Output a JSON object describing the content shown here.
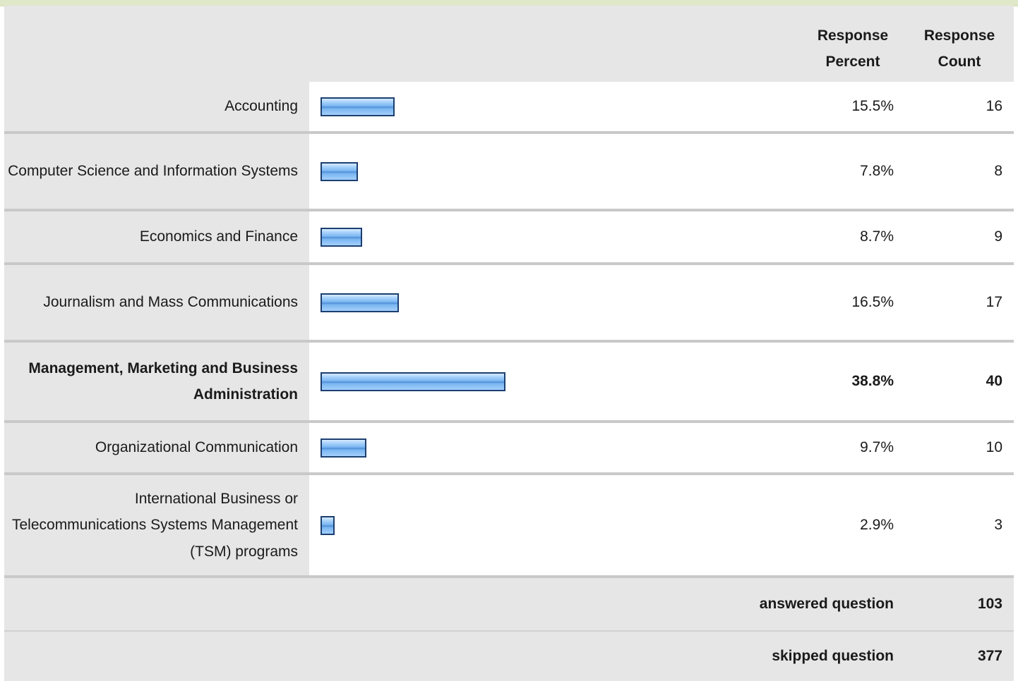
{
  "header": {
    "response_percent": "Response Percent",
    "response_count": "Response Count"
  },
  "chart_data": {
    "type": "bar",
    "orientation": "horizontal",
    "categories": [
      "Accounting",
      "Computer Science and Information Systems",
      "Economics and Finance",
      "Journalism and Mass Communications",
      "Management, Marketing and Business Administration",
      "Organizational Communication",
      "International Business or Telecommunications Systems Management (TSM) programs"
    ],
    "series": [
      {
        "values": [
          15.5,
          7.8,
          8.7,
          16.5,
          38.8,
          9.7,
          2.9
        ]
      }
    ],
    "percent_labels": [
      "15.5%",
      "7.8%",
      "8.7%",
      "16.5%",
      "38.8%",
      "9.7%",
      "2.9%"
    ],
    "counts": [
      "16",
      "8",
      "9",
      "17",
      "40",
      "10",
      "3"
    ],
    "highlighted_category": "Management, Marketing and Business Administration",
    "bar_color": "#7ab6f1",
    "bar_border_color": "#1c3f70"
  },
  "footer": {
    "answered_label": "answered question",
    "answered_value": "103",
    "skipped_label": "skipped question",
    "skipped_value": "377"
  }
}
